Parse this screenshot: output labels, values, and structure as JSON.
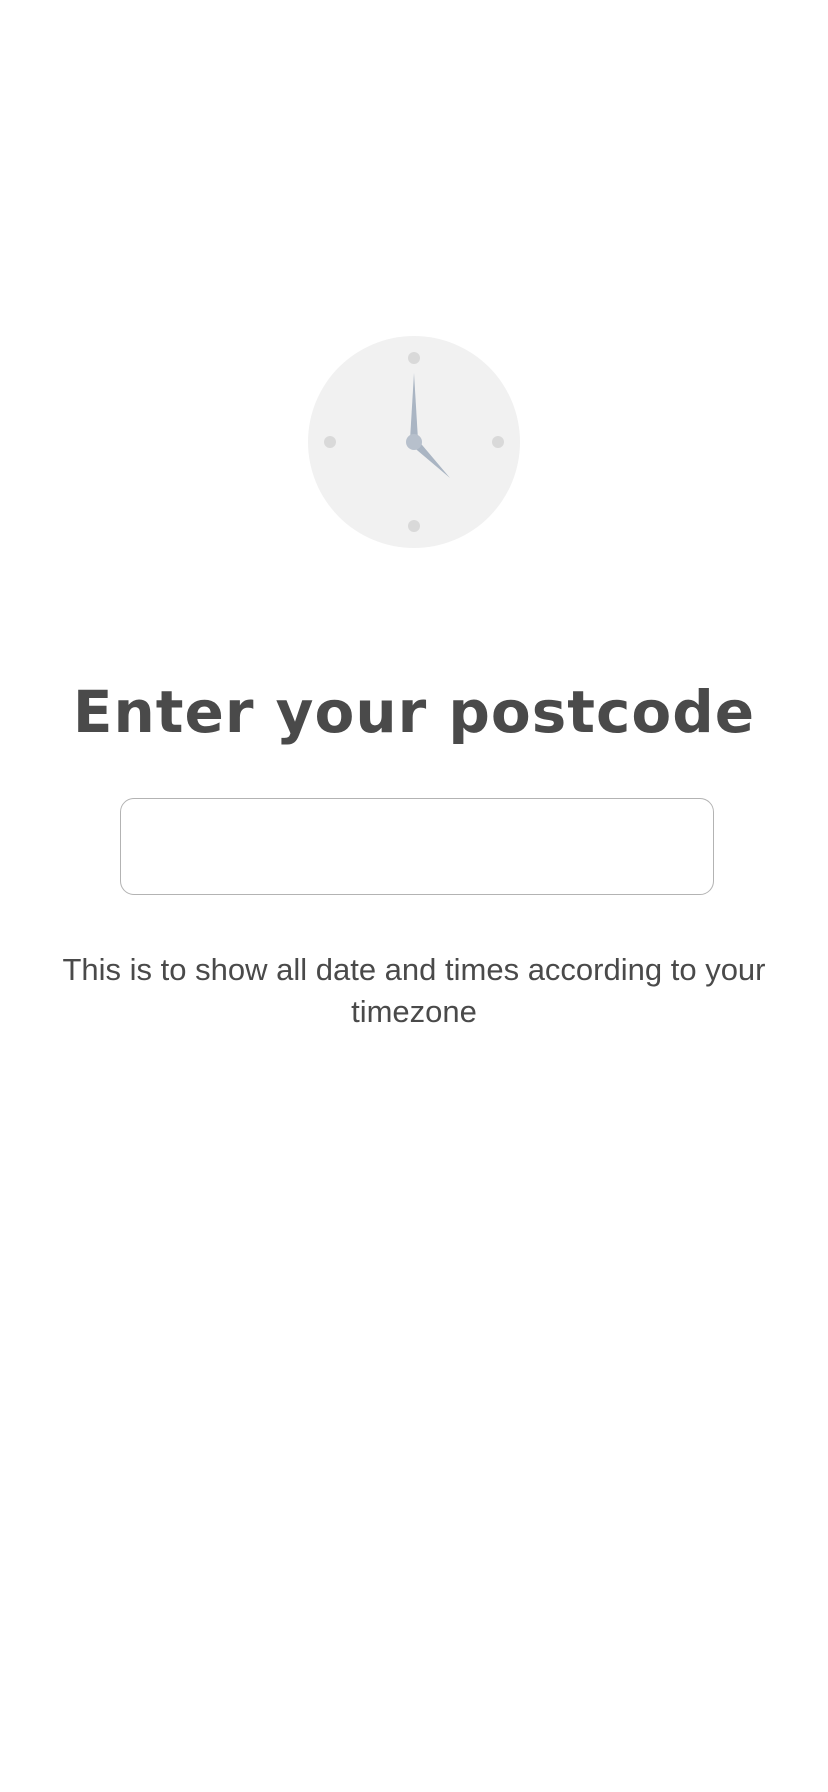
{
  "screen": {
    "illustration_icon": "clock-icon",
    "title": "Enter your postcode",
    "postcode_input": {
      "value": "",
      "placeholder": ""
    },
    "helper_text": "This is to show all date and times according to your timezone"
  },
  "colors": {
    "background": "#ffffff",
    "text": "#4a4a4a",
    "input_border": "#b3b3b3",
    "clock_face": "#f1f1f1",
    "clock_dots": "#d9d9d9",
    "clock_hands": "#aab5c3"
  }
}
